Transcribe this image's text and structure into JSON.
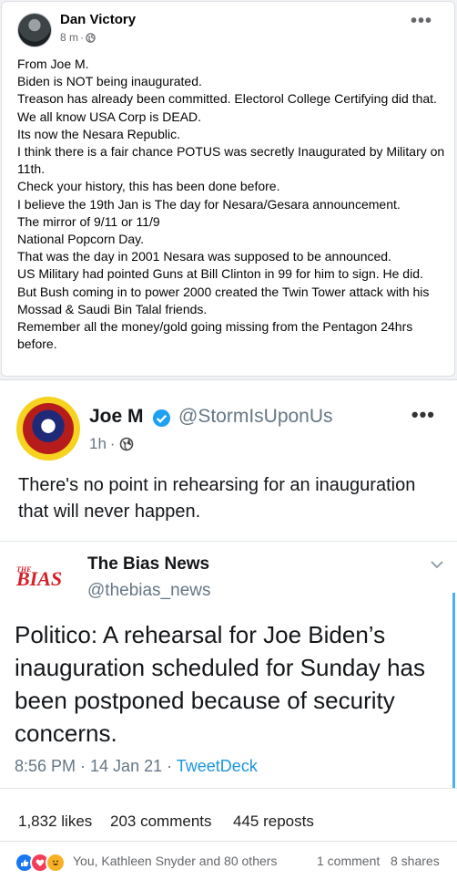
{
  "post": {
    "author": "Dan Victory",
    "time": "8 m",
    "meta_sep": "·",
    "more": "•••",
    "lines": [
      "From Joe M.",
      "Biden is NOT being inaugurated.",
      "Treason has already been committed. Electorol College Certifying did that.",
      "We all know USA Corp is DEAD.",
      "Its now the Nesara Republic.",
      "I think there is a fair chance POTUS was secretly Inaugurated by Military on 11th.",
      "Check your history, this has been done before.",
      "I believe the 19th Jan is The day for Nesara/Gesara announcement.",
      "The mirror of 9/11 or 11/9",
      "National Popcorn Day.",
      "That was the day in 2001 Nesara was supposed to be announced.",
      "US Military had pointed Guns at Bill Clinton in 99 for him to sign. He did. But Bush coming in to power 2000 created the Twin Tower attack with his Mossad & Saudi Bin Talal friends.",
      "Remember all the money/gold going missing from the Pentagon 24hrs before."
    ]
  },
  "tweet": {
    "name": "Joe M",
    "handle": "@StormIsUponUs",
    "time": "1h",
    "sep": "·",
    "more": "•••",
    "text": "There's no point in rehearsing for an inauguration that will never happen.",
    "quoted": {
      "logo_small": "THE",
      "logo": "BIAS",
      "name": "The Bias News",
      "handle": "@thebias_news",
      "text": "Politico: A rehearsal for Joe Biden’s inauguration scheduled for Sunday has been postponed because of security concerns.",
      "timestamp": "8:56 PM · 14 Jan 21 · ",
      "source": "TweetDeck"
    },
    "stats": {
      "likes": "1,832 likes",
      "comments": "203 comments",
      "reposts": "445 reposts"
    }
  },
  "footer": {
    "reactors": "You, Kathleen Snyder and 80 others",
    "comments": "1 comment",
    "shares": "8 shares"
  },
  "colors": {
    "facebook_blue": "#1877f2",
    "twitter_blue": "#1b95e0",
    "verified": "#1da1f2"
  }
}
